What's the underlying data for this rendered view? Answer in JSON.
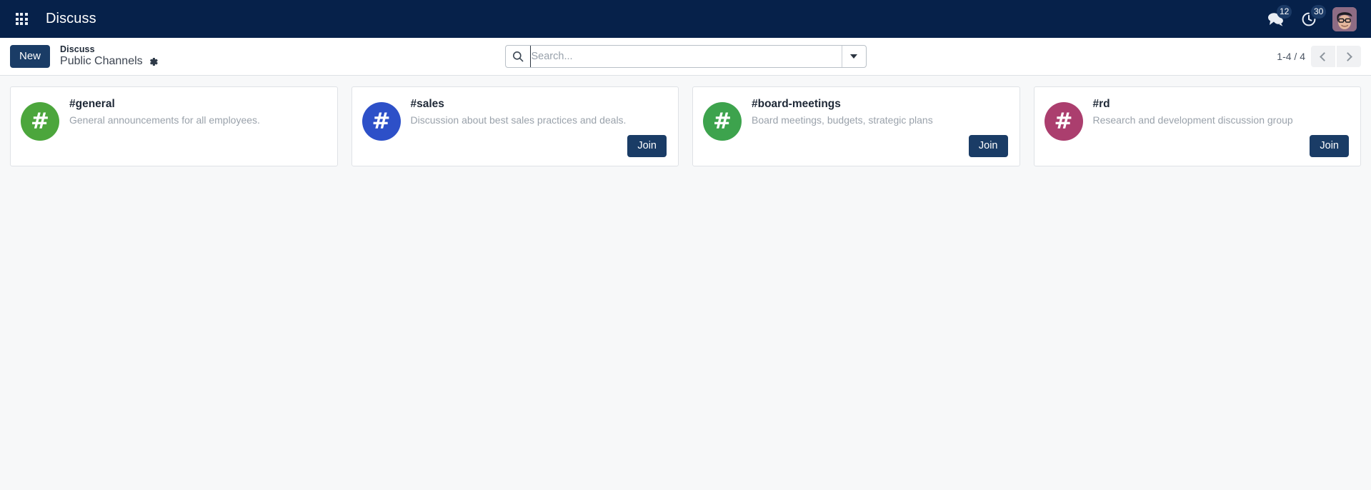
{
  "navbar": {
    "apps_menu_name": "apps-grid-icon",
    "brand": "Discuss",
    "messages": {
      "icon": "chat-bubbles-icon",
      "count": "12"
    },
    "activities": {
      "icon": "clock-activity-icon",
      "count": "30"
    },
    "avatar_alt": "User avatar"
  },
  "control_panel": {
    "new_label": "New",
    "breadcrumb_parent": "Discuss",
    "breadcrumb_current": "Public Channels",
    "settings_icon": "gear-icon",
    "search": {
      "placeholder": "Search...",
      "value": "",
      "icon": "search-icon",
      "toggle_icon": "chevron-down-icon"
    },
    "pager": {
      "count": "1-4 / 4",
      "prev_icon": "chevron-left-icon",
      "next_icon": "chevron-right-icon"
    }
  },
  "channels": [
    {
      "name": "#general",
      "description": "General announcements for all employees.",
      "avatar_color": "#4CA63C",
      "avatar_glyph": "#",
      "join_label": "Join",
      "show_join": false
    },
    {
      "name": "#sales",
      "description": "Discussion about best sales practices and deals.",
      "avatar_color": "#2D50C8",
      "avatar_glyph": "#",
      "join_label": "Join",
      "show_join": true
    },
    {
      "name": "#board-meetings",
      "description": "Board meetings, budgets, strategic plans",
      "avatar_color": "#3DA34D",
      "avatar_glyph": "#",
      "join_label": "Join",
      "show_join": true
    },
    {
      "name": "#rd",
      "description": "Research and development discussion group",
      "avatar_color": "#AB3E6E",
      "avatar_glyph": "#",
      "join_label": "Join",
      "show_join": true
    }
  ],
  "colors": {
    "navbar_bg": "#06214a",
    "primary": "#1a3c66",
    "page_bg": "#f7f8f9",
    "card_bg": "#ffffff"
  }
}
